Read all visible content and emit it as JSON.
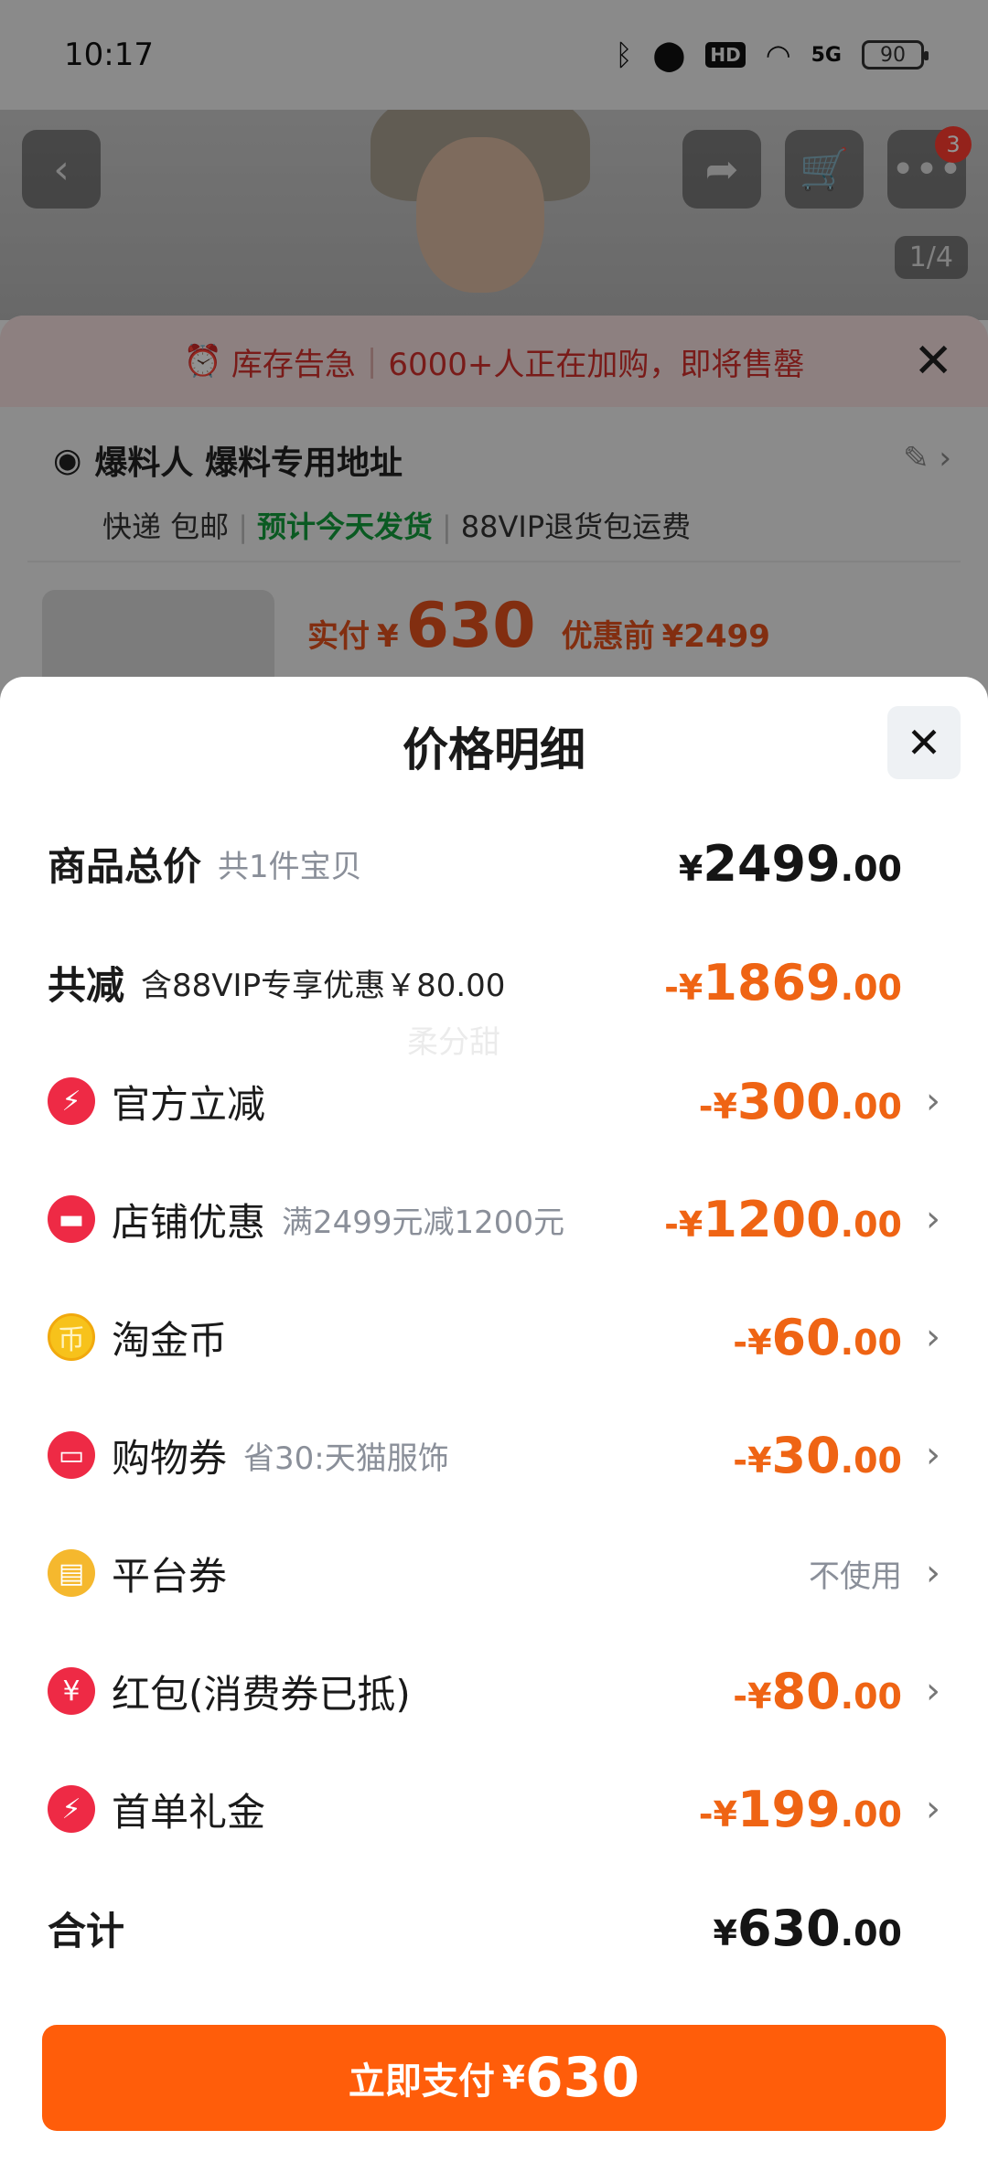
{
  "status_bar": {
    "time": "10:17",
    "hd": "HD",
    "network": "5G",
    "battery": "90"
  },
  "product_page": {
    "cart_count": "3",
    "page_counter": "1/4",
    "stock_alert": {
      "title": "库存告急",
      "message": "6000+人正在加购，即将售罄"
    },
    "address": {
      "name": "爆料人 爆料专用地址",
      "delivery": "快递 包邮",
      "ship_today": "预计今天发货",
      "return_note": "88VIP退货包运费"
    },
    "price_strip": {
      "paid_label": "实付",
      "currency": "¥",
      "paid": "630",
      "before_label": "优惠前",
      "before": "¥2499"
    }
  },
  "sheet": {
    "title": "价格明细",
    "watermark": "柔分甜",
    "total_goods": {
      "label": "商品总价",
      "sub": "共1件宝贝",
      "currency": "¥",
      "int": "2499",
      "dec": ".00"
    },
    "total_discount": {
      "label": "共减",
      "sub": "含88VIP专享优惠￥80.00",
      "currency": "-¥",
      "int": "1869",
      "dec": ".00"
    },
    "items": [
      {
        "label": "官方立减",
        "sub": "",
        "icon": "lightning-icon",
        "icon_color": "#ee2a45",
        "glyph": "⚡",
        "currency": "-¥",
        "int": "300",
        "dec": ".00"
      },
      {
        "label": "店铺优惠",
        "sub": "满2499元减1200元",
        "icon": "store-icon",
        "icon_color": "#ee2a45",
        "glyph": "▬",
        "currency": "-¥",
        "int": "1200",
        "dec": ".00"
      },
      {
        "label": "淘金币",
        "sub": "",
        "icon": "gold-coin-icon",
        "icon_color": "#f7c21b",
        "glyph": "币",
        "currency": "-¥",
        "int": "60",
        "dec": ".00"
      },
      {
        "label": "购物券",
        "sub": "省30:天猫服饰",
        "icon": "ticket-icon",
        "icon_color": "#ee2a45",
        "glyph": "▭",
        "currency": "-¥",
        "int": "30",
        "dec": ".00"
      },
      {
        "label": "平台券",
        "sub": "",
        "icon": "coupon-icon",
        "icon_color": "#f5b82e",
        "glyph": "▤",
        "status": "不使用"
      },
      {
        "label": "红包(消费券已抵)",
        "sub": "",
        "icon": "red-packet-icon",
        "icon_color": "#ee2a45",
        "glyph": "¥",
        "currency": "-¥",
        "int": "80",
        "dec": ".00"
      },
      {
        "label": "首单礼金",
        "sub": "",
        "icon": "lightning-icon",
        "icon_color": "#ee2a45",
        "glyph": "⚡",
        "currency": "-¥",
        "int": "199",
        "dec": ".00"
      }
    ],
    "grand_total": {
      "label": "合计",
      "currency": "¥",
      "int": "630",
      "dec": ".00"
    },
    "pay_button": {
      "label": "立即支付",
      "currency": "¥",
      "value": "630"
    }
  }
}
